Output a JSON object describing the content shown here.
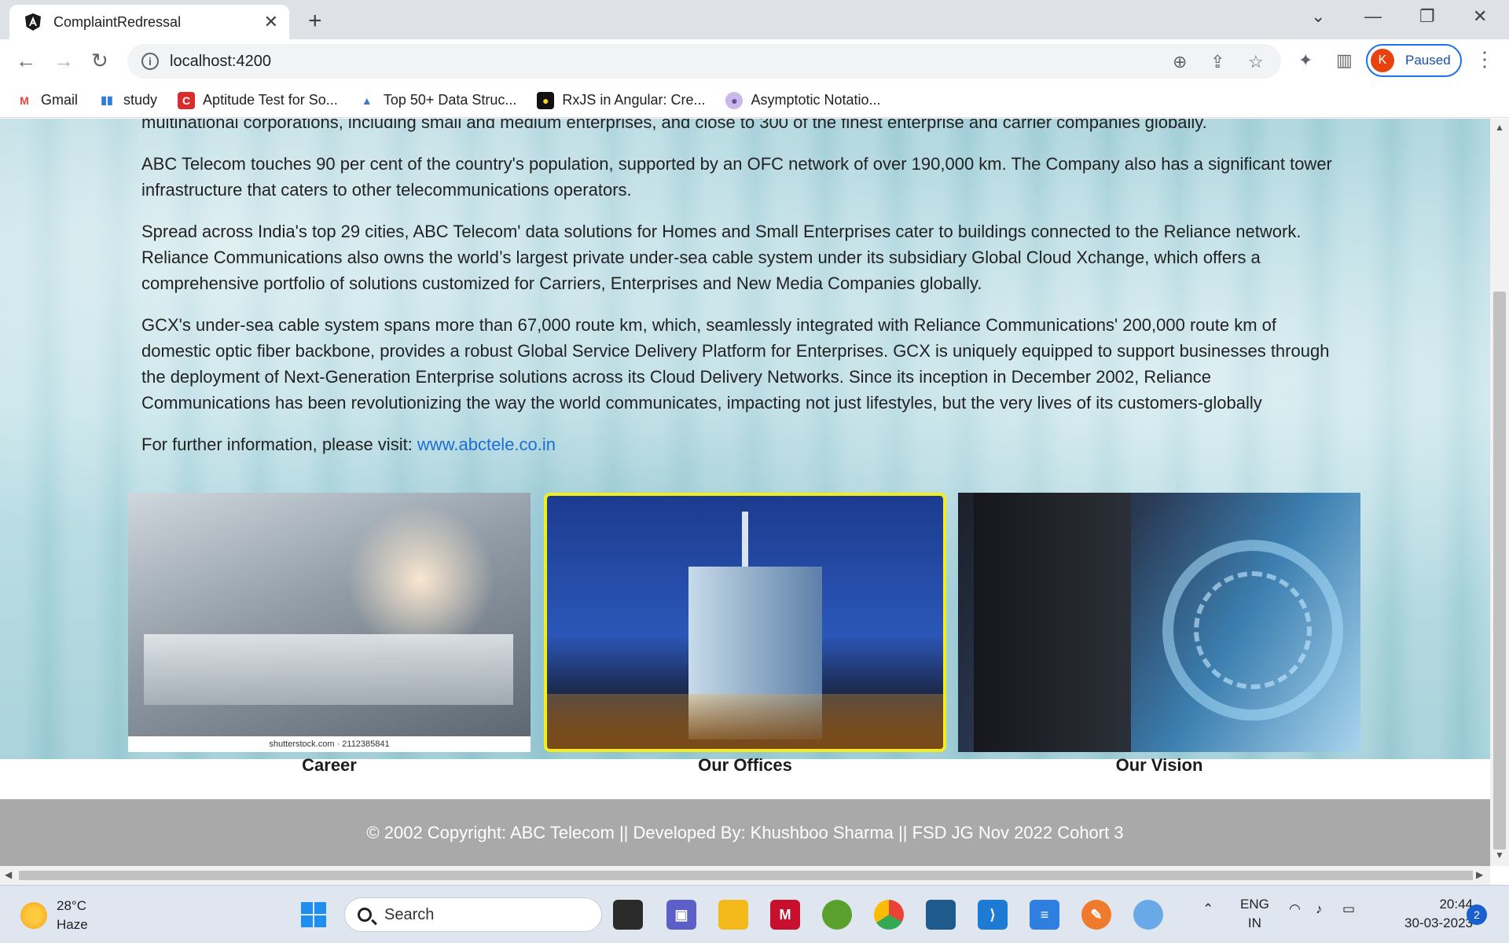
{
  "browser": {
    "tab_title": "ComplaintRedressal",
    "url": "localhost:4200",
    "profile_initial": "K",
    "profile_status": "Paused",
    "bookmarks": [
      {
        "label": "Gmail",
        "icon": "gmail-icon"
      },
      {
        "label": "study",
        "icon": "chart-icon"
      },
      {
        "label": "Aptitude Test for So...",
        "icon": "c-icon"
      },
      {
        "label": "Top 50+ Data Struc...",
        "icon": "mountain-icon"
      },
      {
        "label": "RxJS in Angular: Cre...",
        "icon": "bulb-icon"
      },
      {
        "label": "Asymptotic Notatio...",
        "icon": "avatar-icon"
      }
    ]
  },
  "page": {
    "paragraphs": [
      "multinational corporations, including small and medium enterprises, and close to 300 of the finest enterprise and carrier companies globally.",
      "ABC Telecom touches 90 per cent of the country's population, supported by an OFC network of over 190,000 km. The Company also has a significant tower infrastructure that caters to other telecommunications operators.",
      "Spread across India's top 29 cities, ABC Telecom' data solutions for Homes and Small Enterprises cater to buildings connected to the Reliance network. Reliance Communications also owns the world’s largest private under-sea cable system under its subsidiary Global Cloud Xchange, which offers a comprehensive portfolio of solutions customized for Carriers, Enterprises and New Media Companies globally.",
      "GCX's under-sea cable system spans more than 67,000 route km, which, seamlessly integrated with Reliance Communications' 200,000 route km of domestic optic fiber backbone, provides a robust Global Service Delivery Platform for Enterprises. GCX is uniquely equipped to support businesses through the deployment of Next-Generation Enterprise solutions across its Cloud Delivery Networks. Since its inception in December 2002, Reliance Communications has been revolutionizing the way the world communicates, impacting not just lifestyles, but the very lives of its customers-globally"
    ],
    "further_info_text": "For further information, please visit: ",
    "further_info_link": "www.abctele.co.in",
    "cards": [
      {
        "caption": "Career",
        "watermark": "shutterstock.com · 2112385841"
      },
      {
        "caption": "Our Offices"
      },
      {
        "caption": "Our Vision"
      }
    ],
    "footer": "© 2002 Copyright: ABC Telecom || Developed By: Khushboo Sharma || FSD JG Nov 2022 Cohort 3"
  },
  "taskbar": {
    "temperature": "28°C",
    "condition": "Haze",
    "search_label": "Search",
    "language_line1": "ENG",
    "language_line2": "IN",
    "time": "20:44",
    "date": "30-03-2023",
    "notification_count": "2"
  }
}
